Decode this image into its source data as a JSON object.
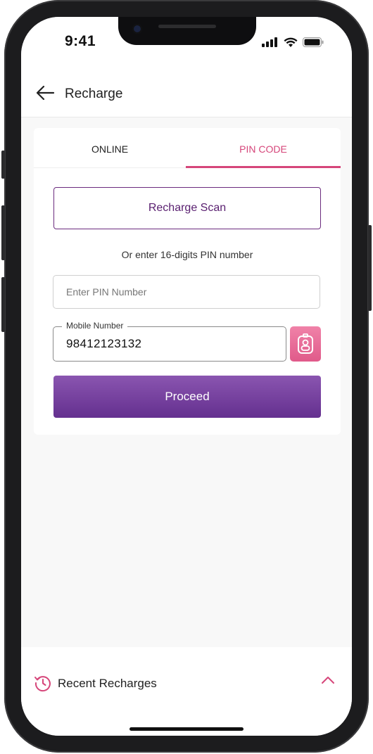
{
  "status_bar": {
    "time": "9:41"
  },
  "header": {
    "title": "Recharge"
  },
  "tabs": [
    {
      "label": "ONLINE",
      "active": false
    },
    {
      "label": "PIN CODE",
      "active": true
    }
  ],
  "form": {
    "scan_label": "Recharge Scan",
    "or_text": "Or enter 16-digits PIN number",
    "pin_placeholder": "Enter PIN Number",
    "mobile_label": "Mobile Number",
    "mobile_value": "98412123132",
    "proceed_label": "Proceed"
  },
  "recent": {
    "label": "Recent Recharges"
  },
  "colors": {
    "accent_pink": "#d6467a",
    "primary_purple": "#64308f",
    "scan_text": "#5a2070"
  },
  "icons": [
    "back-arrow-icon",
    "signal-icon",
    "wifi-icon",
    "battery-icon",
    "contact-book-icon",
    "history-icon",
    "chevron-up-icon"
  ]
}
